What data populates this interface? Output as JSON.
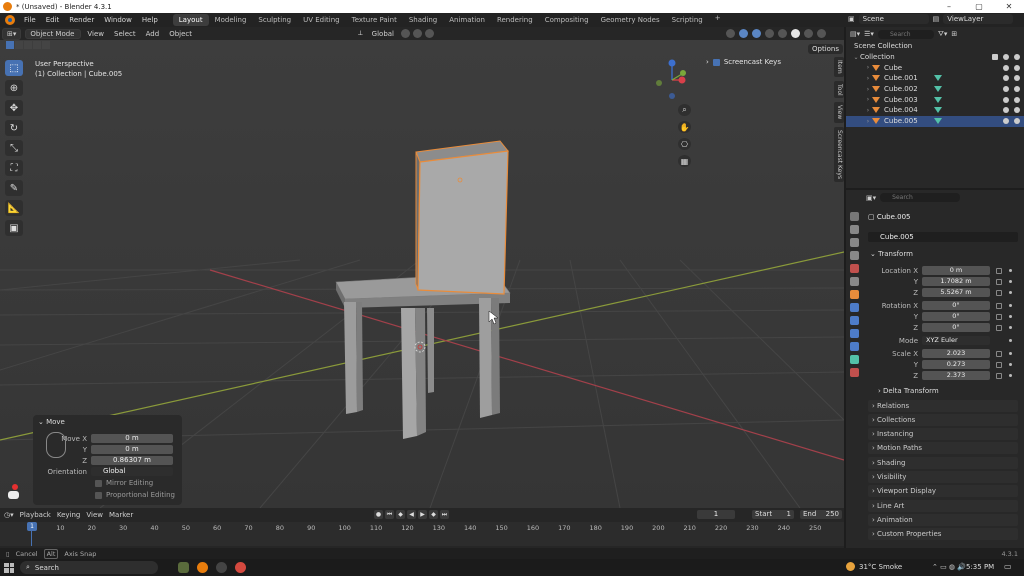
{
  "titlebar": {
    "title": "* (Unsaved) - Blender 4.3.1"
  },
  "menus": [
    "File",
    "Edit",
    "Render",
    "Window",
    "Help"
  ],
  "workspaces": [
    "Layout",
    "Modeling",
    "Sculpting",
    "UV Editing",
    "Texture Paint",
    "Shading",
    "Animation",
    "Rendering",
    "Compositing",
    "Geometry Nodes",
    "Scripting"
  ],
  "active_workspace": "Layout",
  "scene": {
    "scene_name": "Scene",
    "view_layer": "ViewLayer"
  },
  "viewport_header": {
    "mode": "Object Mode",
    "items": [
      "View",
      "Select",
      "Add",
      "Object"
    ],
    "orientation": "Global",
    "options": "Options"
  },
  "viewport": {
    "perspective": "User Perspective",
    "collection_info": "(1) Collection | Cube.005",
    "screencast_label": "Screencast Keys"
  },
  "side_tabs": [
    "Item",
    "Tool",
    "View",
    "Screencast Keys"
  ],
  "operator_panel": {
    "title": "Move",
    "move_x_label": "Move X",
    "y_label": "Y",
    "z_label": "Z",
    "move_x": "0 m",
    "move_y": "0 m",
    "move_z": "0.86307 m",
    "orientation_label": "Orientation",
    "orientation": "Global",
    "mirror_editing": "Mirror Editing",
    "proportional_editing": "Proportional Editing"
  },
  "timeline": {
    "menu": [
      "Playback",
      "Keying",
      "View",
      "Marker"
    ],
    "current_frame": "1",
    "start_label": "Start",
    "start": "1",
    "end_label": "End",
    "end": "250",
    "ruler": [
      "1",
      "10",
      "20",
      "30",
      "40",
      "50",
      "60",
      "70",
      "80",
      "90",
      "100",
      "110",
      "120",
      "130",
      "140",
      "150",
      "160",
      "170",
      "180",
      "190",
      "200",
      "210",
      "220",
      "230",
      "240",
      "250"
    ]
  },
  "statusbar": {
    "cancel": "Cancel",
    "alt_key": "Alt",
    "axis_snap": "Axis Snap",
    "version": "4.3.1"
  },
  "outliner": {
    "search_placeholder": "Search",
    "scene_collection": "Scene Collection",
    "collection": "Collection",
    "objects": [
      "Cube",
      "Cube.001",
      "Cube.002",
      "Cube.003",
      "Cube.004",
      "Cube.005"
    ],
    "selected": "Cube.005"
  },
  "properties": {
    "search_placeholder": "Search",
    "object_name": "Cube.005",
    "object_field": "Cube.005",
    "transform_title": "Transform",
    "location_x_label": "Location X",
    "rotation_x_label": "Rotation X",
    "scale_x_label": "Scale X",
    "y_label": "Y",
    "z_label": "Z",
    "mode_label": "Mode",
    "location": [
      "0 m",
      "1.7082 m",
      "5.5267 m"
    ],
    "rotation": [
      "0°",
      "0°",
      "0°"
    ],
    "mode": "XYZ Euler",
    "scale": [
      "2.023",
      "0.273",
      "2.373"
    ],
    "delta_transform": "Delta Transform",
    "panels": [
      "Relations",
      "Collections",
      "Instancing",
      "Motion Paths",
      "Shading",
      "Visibility",
      "Viewport Display",
      "Line Art",
      "Animation",
      "Custom Properties"
    ]
  },
  "taskbar": {
    "search": "Search",
    "weather": "31°C Smoke",
    "time": "5:35 PM"
  },
  "colors": {
    "accent": "#4772b3",
    "selection_orange": "#e98c3b",
    "background": "#3b3b3b"
  }
}
